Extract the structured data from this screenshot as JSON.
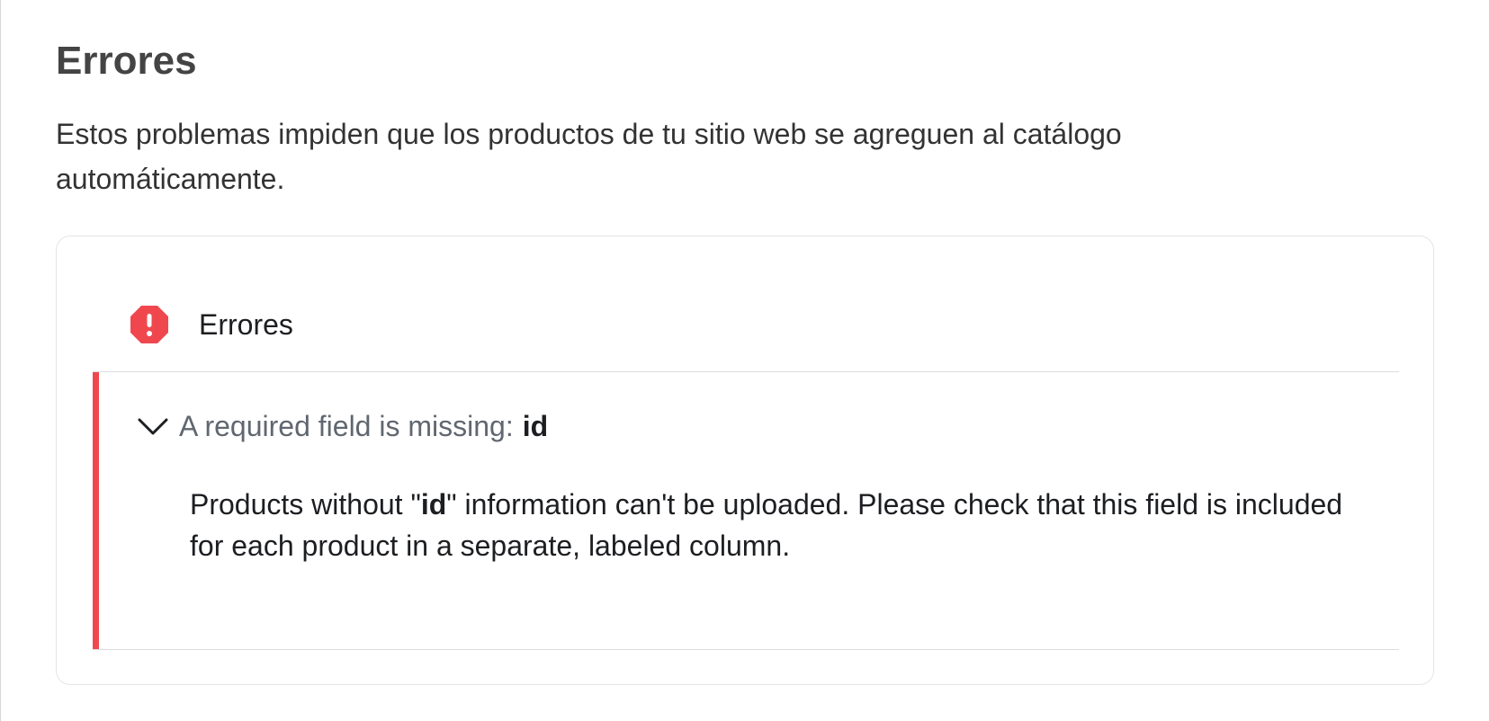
{
  "page": {
    "title": "Errores",
    "description": "Estos problemas impiden que los productos de tu sitio web se agreguen al catálogo automáticamente."
  },
  "errors_section": {
    "icon": "error-octagon-icon",
    "title": "Errores",
    "accent_color": "#f0474f",
    "items": [
      {
        "title": "A required field is missing:",
        "field": "id",
        "message_before": "Products without \"",
        "message_field": "id",
        "message_after": "\" information can't be uploaded. Please check that this field is included for each product in a separate, labeled column.",
        "expanded": true
      }
    ]
  }
}
